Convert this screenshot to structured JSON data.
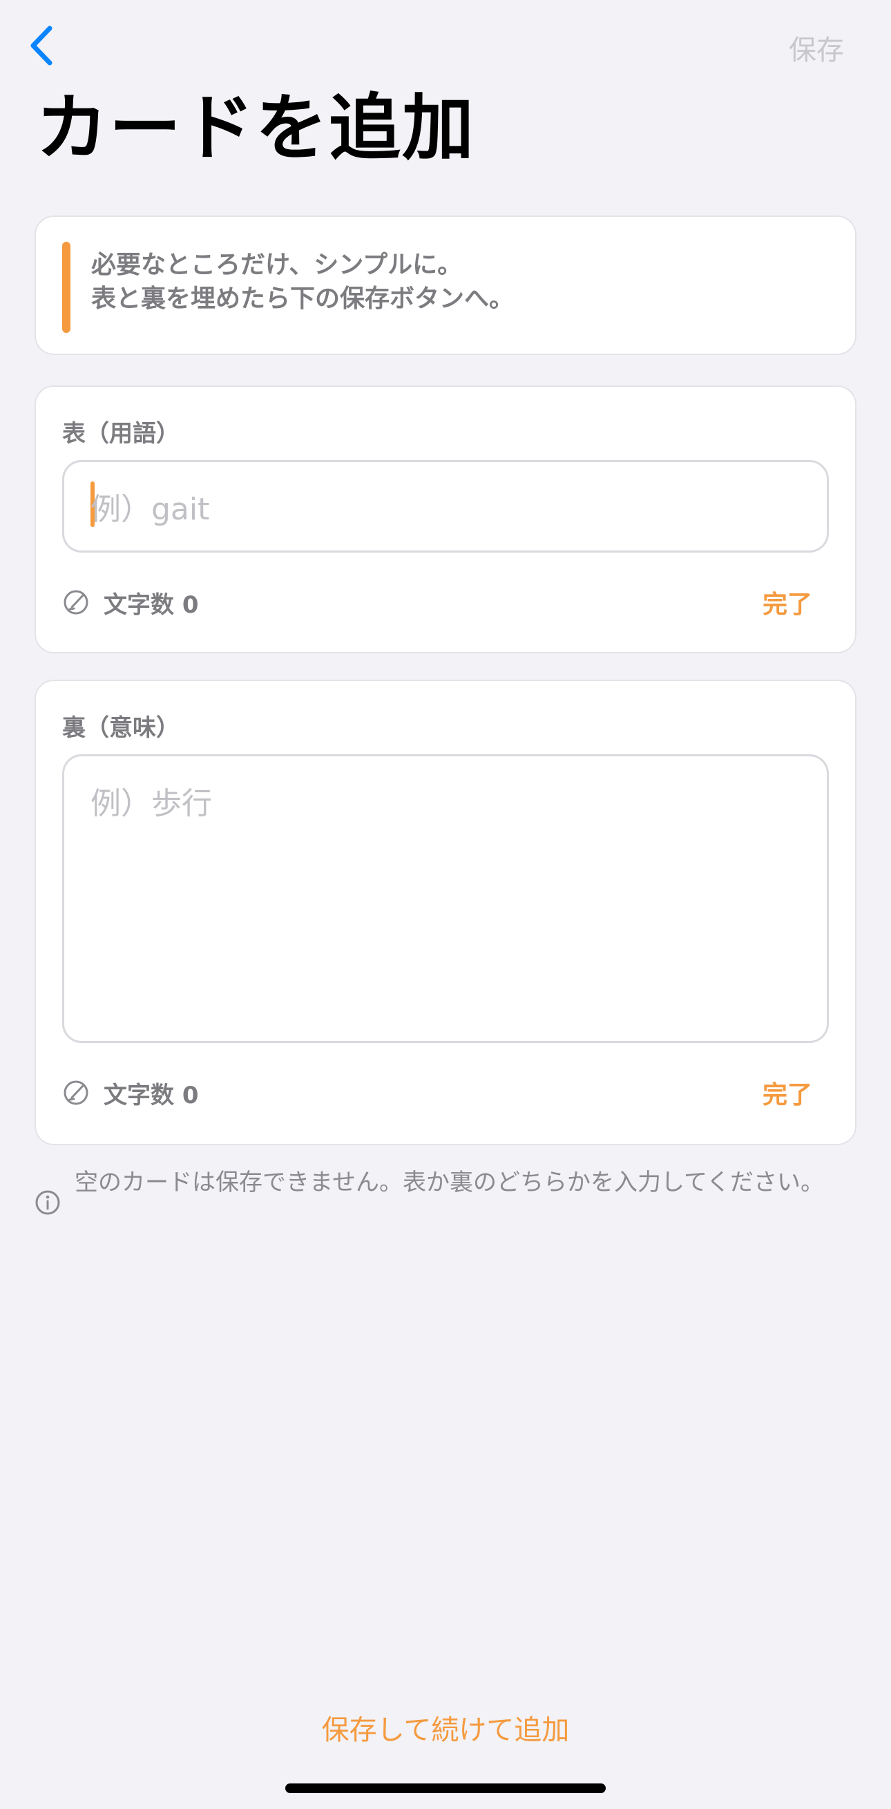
{
  "header": {
    "back_icon": "chevron-left-icon",
    "save_label": "保存",
    "title": "カードを追加"
  },
  "hint": {
    "line1": "必要なところだけ、シンプルに。",
    "line2": "表と裏を埋めたら下の保存ボタンへ。",
    "accent_color": "#F59A3E"
  },
  "front": {
    "label": "表（用語）",
    "placeholder": "例）gait",
    "value": "",
    "char_count_label": "文字数 0",
    "done_label": "完了"
  },
  "back": {
    "label": "裏（意味）",
    "placeholder": "例）歩行",
    "value": "",
    "char_count_label": "文字数 0",
    "done_label": "完了"
  },
  "notice": {
    "icon": "info-icon",
    "text": "空のカードは保存できません。表か裏のどちらかを入力してください。"
  },
  "footer": {
    "save_continue_label": "保存して続けて追加"
  },
  "colors": {
    "background": "#F2F2F7",
    "accent": "#F59A3E",
    "back_button": "#0A84FF",
    "disabled_text": "#C7C7CC"
  }
}
